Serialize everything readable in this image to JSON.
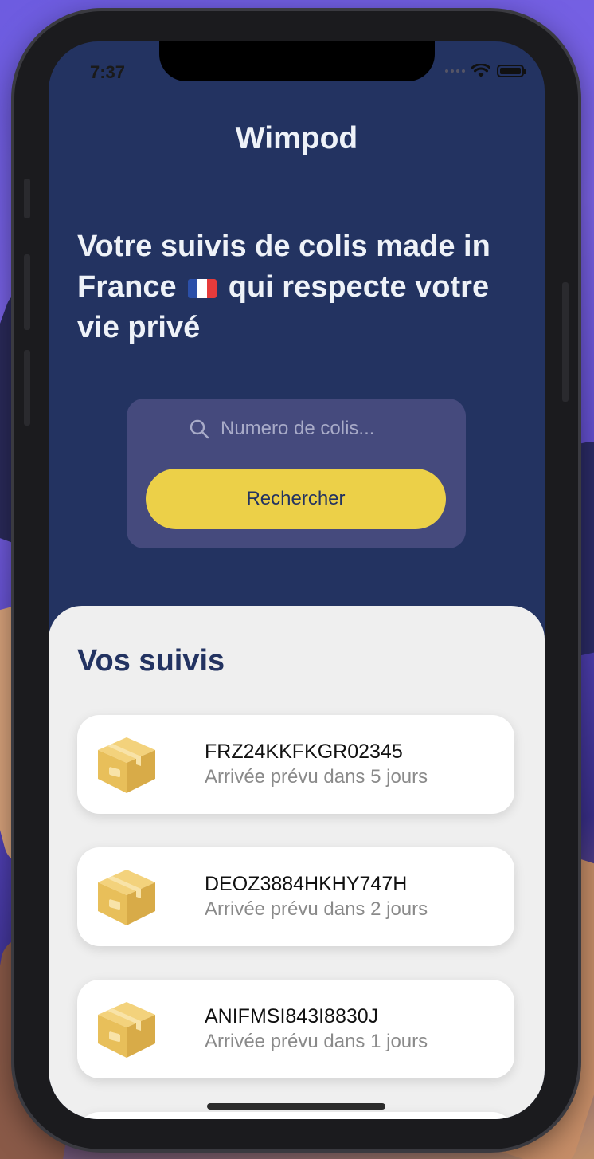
{
  "status": {
    "time": "7:37"
  },
  "app": {
    "title": "Wimpod"
  },
  "hero": {
    "line1": "Votre suivis de colis made in",
    "line2a": "France",
    "line2b": "qui respecte votre",
    "line3": "vie privé"
  },
  "search": {
    "placeholder": "Numero de colis...",
    "button_label": "Rechercher"
  },
  "tracking": {
    "title": "Vos suivis",
    "items": [
      {
        "code": "FRZ24KKFKGR02345",
        "eta": "Arrivée prévu dans 5 jours"
      },
      {
        "code": "DEOZ3884HKHY747H",
        "eta": "Arrivée prévu dans 2 jours"
      },
      {
        "code": "ANIFMSI843I8830J",
        "eta": "Arrivée prévu dans 1 jours"
      }
    ]
  },
  "colors": {
    "primary": "#233361",
    "accent": "#ecd048",
    "panel": "#efefef"
  },
  "icons": {
    "package": "package-icon",
    "search": "search-icon",
    "flag": "france-flag-icon"
  }
}
